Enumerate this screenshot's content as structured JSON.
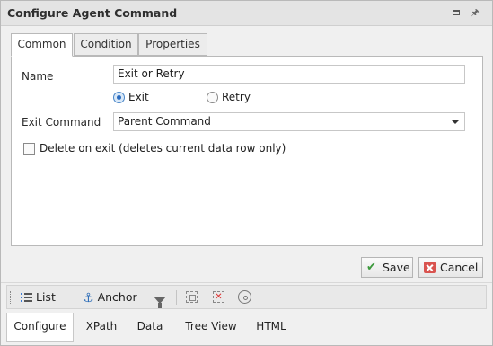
{
  "window": {
    "title": "Configure Agent Command"
  },
  "tabs": [
    {
      "label": "Common",
      "active": true
    },
    {
      "label": "Condition",
      "active": false
    },
    {
      "label": "Properties",
      "active": false
    }
  ],
  "form": {
    "name_label": "Name",
    "name_value": "Exit or Retry",
    "radio_exit_label": "Exit",
    "radio_retry_label": "Retry",
    "radio_selected": "Exit",
    "exit_command_label": "Exit Command",
    "exit_command_value": "Parent Command",
    "delete_on_exit_label": "Delete on exit (deletes current data row only)",
    "delete_on_exit_checked": false
  },
  "buttons": {
    "save_label": "Save",
    "cancel_label": "Cancel"
  },
  "toolbar": {
    "list_label": "List",
    "anchor_label": "Anchor"
  },
  "bottom_tabs": [
    {
      "label": "Configure",
      "active": true
    },
    {
      "label": "XPath",
      "active": false
    },
    {
      "label": "Data",
      "active": false
    },
    {
      "label": "Tree View",
      "active": false
    },
    {
      "label": "HTML",
      "active": false
    }
  ],
  "colors": {
    "accent": "#2a6bbf",
    "save_icon": "#3d9a3d",
    "cancel_icon": "#d9534f"
  }
}
